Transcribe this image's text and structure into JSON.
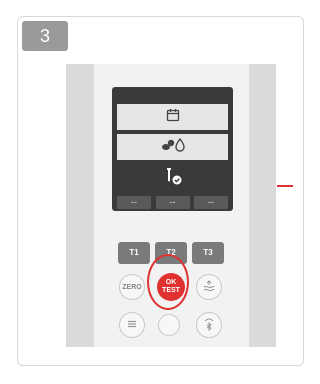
{
  "step": {
    "number": "3"
  },
  "screen": {
    "rows": [
      {
        "icon": "calendar-icon"
      },
      {
        "icon": "tablets-drop-icon"
      },
      {
        "icon": "tube-check-icon"
      }
    ],
    "softkeys": [
      "--",
      "--",
      "--"
    ]
  },
  "keypad": {
    "t1": "T1",
    "t2": "T2",
    "t3": "T3",
    "zero": "ZERO",
    "ok_line1": "OK",
    "ok_line2": "TEST"
  },
  "colors": {
    "accent_red": "#e03131",
    "screen_dark": "#3a3a3a",
    "badge_gray": "#9a9a9a"
  }
}
